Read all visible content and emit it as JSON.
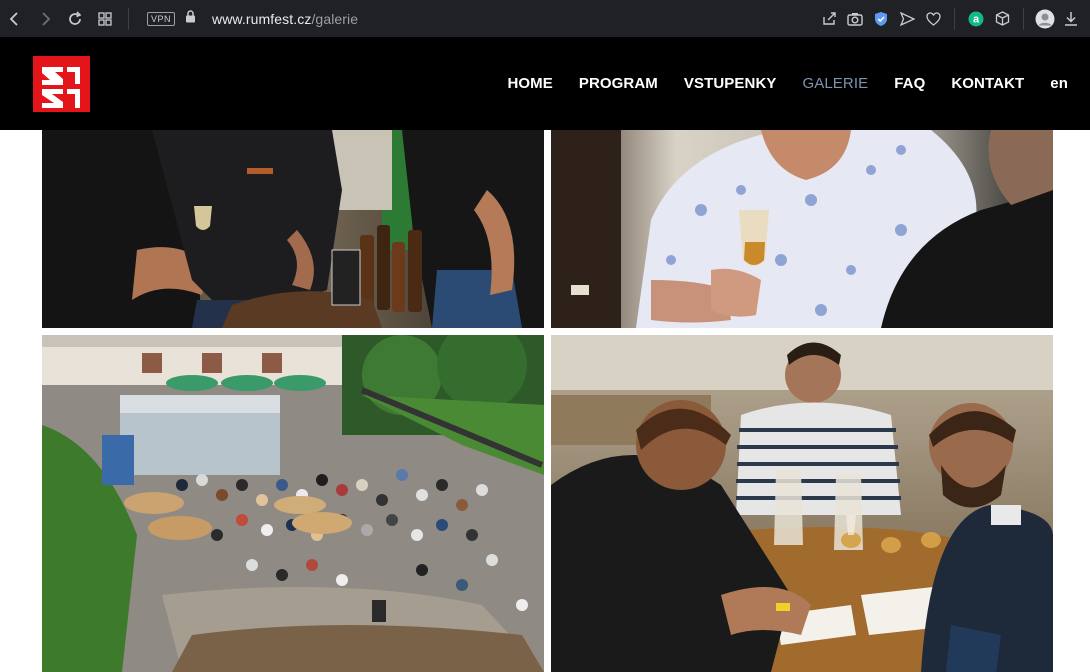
{
  "browser": {
    "vpn_label": "VPN",
    "url_domain": "www.rumfest.cz",
    "url_path": "/galerie"
  },
  "site": {
    "logo_text": "XR",
    "brand_color": "#e3151a",
    "nav": [
      {
        "label": "HOME",
        "active": false
      },
      {
        "label": "PROGRAM",
        "active": false
      },
      {
        "label": "VSTUPENKY",
        "active": false
      },
      {
        "label": "GALERIE",
        "active": true
      },
      {
        "label": "FAQ",
        "active": false
      },
      {
        "label": "KONTAKT",
        "active": false
      },
      {
        "label": "en",
        "active": false
      }
    ],
    "active_color": "#7e93b3"
  },
  "gallery": {
    "photos": [
      {
        "subject": "Men in black shirts at a rum stand tasting from glasses"
      },
      {
        "subject": "Man in floral shirt nosing a glass of rum"
      },
      {
        "subject": "Aerial view of crowded festival courtyard with umbrellas"
      },
      {
        "subject": "Men taking notes at a rum tasting table"
      }
    ]
  }
}
